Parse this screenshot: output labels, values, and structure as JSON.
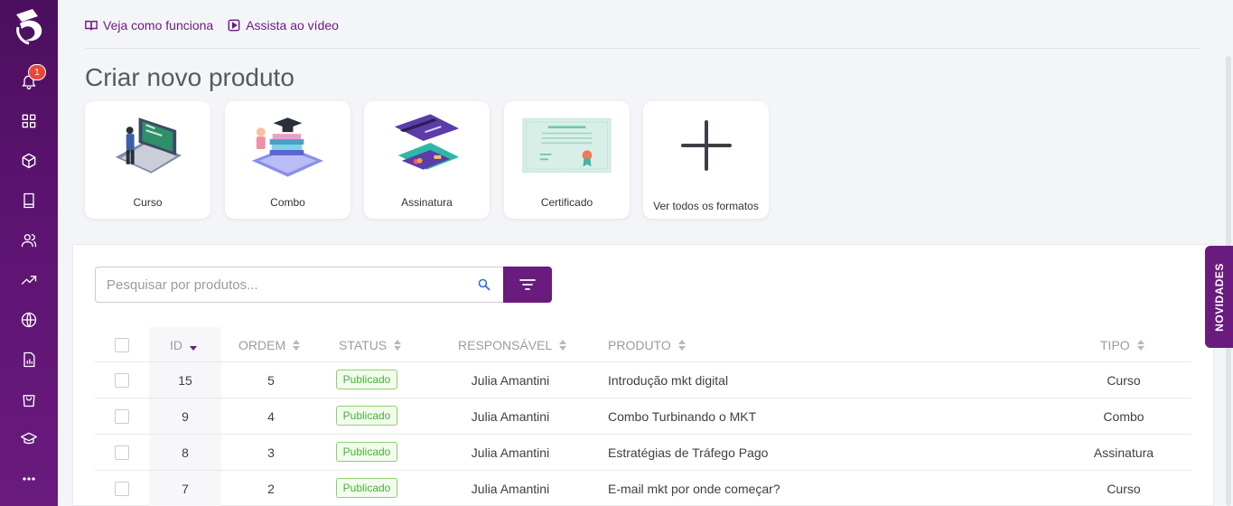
{
  "sidebar": {
    "notification_count": "1",
    "icons": [
      "bell-icon",
      "dashboard-grid-icon",
      "box-icon",
      "book-icon",
      "users-icon",
      "trending-up-icon",
      "globe-icon",
      "report-icon",
      "shopping-bag-icon",
      "graduation-cap-icon",
      "more-icon"
    ]
  },
  "top_links": {
    "how_it_works": "Veja como funciona",
    "watch_video": "Assista ao vídeo"
  },
  "page_title": "Criar novo produto",
  "cards": [
    {
      "label": "Curso"
    },
    {
      "label": "Combo"
    },
    {
      "label": "Assinatura"
    },
    {
      "label": "Certificado"
    },
    {
      "label": "Ver todos os formatos"
    }
  ],
  "search": {
    "placeholder": "Pesquisar por produtos..."
  },
  "novidades_label": "NOVIDADES",
  "table": {
    "headers": {
      "id": "ID",
      "ordem": "ORDEM",
      "status": "STATUS",
      "responsavel": "RESPONSÁVEL",
      "produto": "PRODUTO",
      "tipo": "TIPO"
    },
    "rows": [
      {
        "id": "15",
        "ordem": "5",
        "status": "Publicado",
        "responsavel": "Julia Amantini",
        "produto": "Introdução mkt digital",
        "tipo": "Curso"
      },
      {
        "id": "9",
        "ordem": "4",
        "status": "Publicado",
        "responsavel": "Julia Amantini",
        "produto": "Combo Turbinando o MKT",
        "tipo": "Combo"
      },
      {
        "id": "8",
        "ordem": "3",
        "status": "Publicado",
        "responsavel": "Julia Amantini",
        "produto": "Estratégias de Tráfego Pago",
        "tipo": "Assinatura"
      },
      {
        "id": "7",
        "ordem": "2",
        "status": "Publicado",
        "responsavel": "Julia Amantini",
        "produto": "E-mail mkt por onde começar?",
        "tipo": "Curso"
      }
    ]
  },
  "colors": {
    "brand_purple": "#6a1b7e",
    "status_green": "#4caf3a",
    "notification_red": "#e8473c"
  }
}
